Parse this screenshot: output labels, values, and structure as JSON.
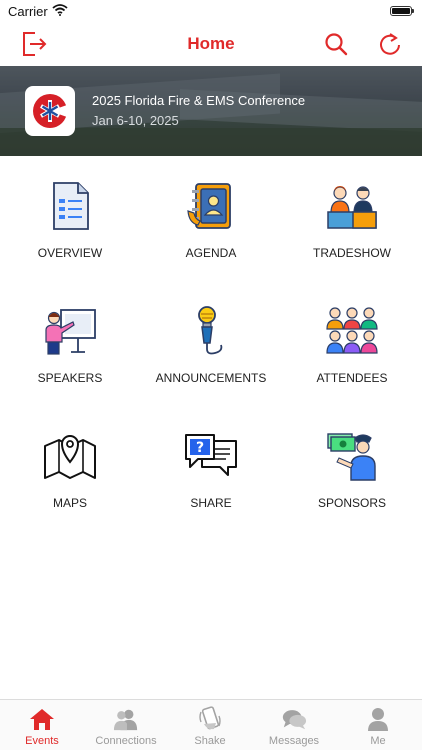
{
  "status_bar": {
    "carrier": "Carrier"
  },
  "nav": {
    "title": "Home"
  },
  "colors": {
    "accent": "#e02a2a",
    "inactive": "#9a9a9a"
  },
  "event": {
    "title": "2025 Florida Fire & EMS Conference",
    "dates": "Jan 6-10, 2025"
  },
  "menu": [
    {
      "label": "OVERVIEW",
      "icon": "document-icon"
    },
    {
      "label": "AGENDA",
      "icon": "address-book-icon"
    },
    {
      "label": "TRADESHOW",
      "icon": "booth-icon"
    },
    {
      "label": "SPEAKERS",
      "icon": "presenter-icon"
    },
    {
      "label": "ANNOUNCEMENTS",
      "icon": "microphone-icon"
    },
    {
      "label": "ATTENDEES",
      "icon": "people-group-icon"
    },
    {
      "label": "MAPS",
      "icon": "map-icon"
    },
    {
      "label": "SHARE",
      "icon": "chat-bubble-icon"
    },
    {
      "label": "SPONSORS",
      "icon": "sponsor-icon"
    }
  ],
  "tabs": [
    {
      "label": "Events",
      "icon": "home-icon",
      "active": true
    },
    {
      "label": "Connections",
      "icon": "users-icon",
      "active": false
    },
    {
      "label": "Shake",
      "icon": "phone-shake-icon",
      "active": false
    },
    {
      "label": "Messages",
      "icon": "messages-icon",
      "active": false
    },
    {
      "label": "Me",
      "icon": "person-icon",
      "active": false
    }
  ]
}
